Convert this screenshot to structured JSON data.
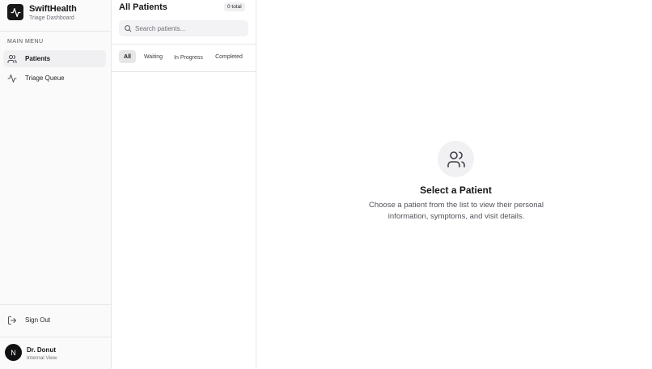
{
  "brand": {
    "name": "SwiftHealth",
    "subtitle": "Triage Dashboard",
    "logo_icon": "activity-icon"
  },
  "sidebar": {
    "section_label": "MAIN MENU",
    "items": [
      {
        "label": "Patients",
        "icon": "users-icon",
        "active": true
      },
      {
        "label": "Triage Queue",
        "icon": "activity-icon",
        "active": false
      }
    ],
    "sign_out": {
      "label": "Sign Out",
      "icon": "log-out-icon"
    },
    "user": {
      "initial": "N",
      "name": "Dr. Donut",
      "role": "Internal View"
    }
  },
  "patient_list": {
    "title": "All Patients",
    "count": "0 total",
    "search": {
      "placeholder": "Search patients...",
      "value": ""
    },
    "tabs": [
      {
        "label": "All",
        "active": true
      },
      {
        "label": "Waiting",
        "active": false
      },
      {
        "label": "In Progress",
        "active": false
      },
      {
        "label": "Completed",
        "active": false
      }
    ]
  },
  "empty_state": {
    "icon": "users-icon",
    "title": "Select a Patient",
    "description": "Choose a patient from the list to view their personal information, symptoms, and visit details."
  },
  "colors": {
    "accent": "#18181b",
    "muted": "#71717a",
    "border": "#e7e7e9",
    "surface": "#f3f3f5"
  }
}
